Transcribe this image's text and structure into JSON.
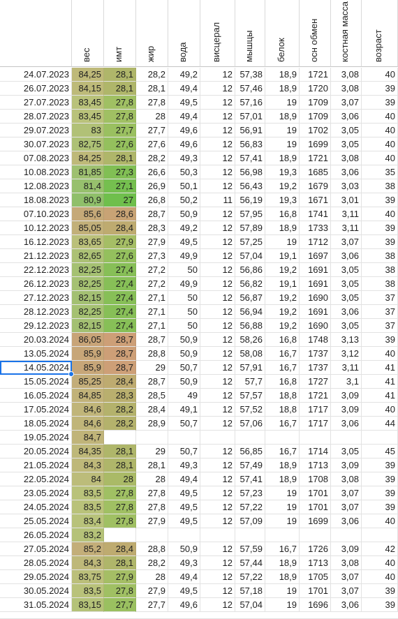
{
  "headers": [
    "",
    "вес",
    "имт",
    "жир",
    "вода",
    "висцерал",
    "мышцы",
    "белок",
    "осн обмен",
    "костная масса",
    "возраст"
  ],
  "colors": {
    "grid": "#e2e2e2",
    "selection": "#1a73e8",
    "weight_scale": [
      "#8fbf6a",
      "#b9c27a",
      "#c8a478"
    ],
    "bmi_scale": [
      "#6fbf4c",
      "#a3c064",
      "#cd9f77"
    ]
  },
  "selected_row": 21,
  "rows": [
    [
      "24.07.2023",
      "84,25",
      "28,1",
      "28,2",
      "49,2",
      "12",
      "57,38",
      "18,9",
      "1721",
      "3,08",
      "40"
    ],
    [
      "26.07.2023",
      "84,15",
      "28,1",
      "28,1",
      "49,4",
      "12",
      "57,46",
      "18,9",
      "1720",
      "3,08",
      "39"
    ],
    [
      "27.07.2023",
      "83,45",
      "27,8",
      "27,8",
      "49,5",
      "12",
      "57,16",
      "19",
      "1709",
      "3,07",
      "39"
    ],
    [
      "28.07.2023",
      "83,45",
      "27,8",
      "28",
      "49,4",
      "12",
      "57,01",
      "18,9",
      "1709",
      "3,06",
      "40"
    ],
    [
      "29.07.2023",
      "83",
      "27,7",
      "27,7",
      "49,6",
      "12",
      "56,91",
      "19",
      "1702",
      "3,05",
      "40"
    ],
    [
      "30.07.2023",
      "82,75",
      "27,6",
      "27,6",
      "49,6",
      "12",
      "56,83",
      "19",
      "1699",
      "3,05",
      "40"
    ],
    [
      "07.08.2023",
      "84,25",
      "28,1",
      "28,2",
      "49,3",
      "12",
      "57,41",
      "18,9",
      "1721",
      "3,08",
      "40"
    ],
    [
      "10.08.2023",
      "81,85",
      "27,3",
      "26,6",
      "50,3",
      "12",
      "56,98",
      "19,3",
      "1685",
      "3,06",
      "35"
    ],
    [
      "12.08.2023",
      "81,4",
      "27,1",
      "26,9",
      "50,1",
      "12",
      "56,43",
      "19,2",
      "1679",
      "3,03",
      "38"
    ],
    [
      "18.08.2023",
      "80,9",
      "27",
      "26,8",
      "50,2",
      "11",
      "56,19",
      "19,3",
      "1671",
      "3,01",
      "39"
    ],
    [
      "07.10.2023",
      "85,6",
      "28,6",
      "28,7",
      "50,9",
      "12",
      "57,95",
      "16,8",
      "1741",
      "3,11",
      "40"
    ],
    [
      "10.12.2023",
      "85,05",
      "28,4",
      "28,3",
      "49,2",
      "12",
      "57,89",
      "18,9",
      "1733",
      "3,11",
      "39"
    ],
    [
      "16.12.2023",
      "83,65",
      "27,9",
      "27,9",
      "49,5",
      "12",
      "57,25",
      "19",
      "1712",
      "3,07",
      "39"
    ],
    [
      "21.12.2023",
      "82,65",
      "27,6",
      "27,3",
      "49,9",
      "12",
      "57,04",
      "19,1",
      "1697",
      "3,06",
      "38"
    ],
    [
      "22.12.2023",
      "82,25",
      "27,4",
      "27,2",
      "50",
      "12",
      "56,86",
      "19,2",
      "1691",
      "3,05",
      "38"
    ],
    [
      "26.12.2023",
      "82,25",
      "27,4",
      "27,2",
      "49,9",
      "12",
      "56,82",
      "19,1",
      "1691",
      "3,05",
      "38"
    ],
    [
      "27.12.2023",
      "82,15",
      "27,4",
      "27,1",
      "50",
      "12",
      "56,87",
      "19,2",
      "1690",
      "3,05",
      "37"
    ],
    [
      "28.12.2023",
      "82,25",
      "27,4",
      "27,1",
      "50",
      "12",
      "56,94",
      "19,2",
      "1691",
      "3,06",
      "37"
    ],
    [
      "29.12.2023",
      "82,15",
      "27,4",
      "27,1",
      "50",
      "12",
      "56,88",
      "19,2",
      "1690",
      "3,05",
      "37"
    ],
    [
      "20.03.2024",
      "86,05",
      "28,7",
      "28,7",
      "50,9",
      "12",
      "58,26",
      "16,8",
      "1748",
      "3,13",
      "39"
    ],
    [
      "13.05.2024",
      "85,9",
      "28,7",
      "28,8",
      "50,9",
      "12",
      "58,08",
      "16,7",
      "1737",
      "3,12",
      "40"
    ],
    [
      "14.05.2024",
      "85,9",
      "28,7",
      "29",
      "50,7",
      "12",
      "57,91",
      "16,7",
      "1737",
      "3,11",
      "41"
    ],
    [
      "15.05.2024",
      "85,25",
      "28,4",
      "28,7",
      "50,9",
      "12",
      "57,7",
      "16,8",
      "1727",
      "3,1",
      "41"
    ],
    [
      "16.05.2024",
      "84,85",
      "28,3",
      "28,5",
      "49",
      "12",
      "57,57",
      "18,8",
      "1721",
      "3,09",
      "41"
    ],
    [
      "17.05.2024",
      "84,6",
      "28,2",
      "28,4",
      "49,1",
      "12",
      "57,52",
      "18,8",
      "1717",
      "3,09",
      "40"
    ],
    [
      "18.05.2024",
      "84,6",
      "28,2",
      "28,9",
      "50,7",
      "12",
      "57,06",
      "16,7",
      "1717",
      "3,06",
      "44"
    ],
    [
      "19.05.2024",
      "84,7",
      "",
      "",
      "",
      "",
      "",
      "",
      "",
      "",
      ""
    ],
    [
      "20.05.2024",
      "84,35",
      "28,1",
      "29",
      "50,7",
      "12",
      "56,85",
      "16,7",
      "1714",
      "3,05",
      "45"
    ],
    [
      "21.05.2024",
      "84,3",
      "28,1",
      "28,1",
      "49,3",
      "12",
      "57,49",
      "18,9",
      "1713",
      "3,09",
      "39"
    ],
    [
      "22.05.2024",
      "84",
      "28",
      "28",
      "49,4",
      "12",
      "57,41",
      "18,9",
      "1708",
      "3,08",
      "39"
    ],
    [
      "23.05.2024",
      "83,5",
      "27,8",
      "27,8",
      "49,5",
      "12",
      "57,23",
      "19",
      "1701",
      "3,07",
      "39"
    ],
    [
      "24.05.2024",
      "83,5",
      "27,8",
      "27,8",
      "49,5",
      "12",
      "57,22",
      "19",
      "1701",
      "3,07",
      "39"
    ],
    [
      "25.05.2024",
      "83,4",
      "27,8",
      "27,9",
      "49,5",
      "12",
      "57,09",
      "19",
      "1699",
      "3,06",
      "40"
    ],
    [
      "26.05.2024",
      "83,2",
      "",
      "",
      "",
      "",
      "",
      "",
      "",
      "",
      ""
    ],
    [
      "27.05.2024",
      "85,2",
      "28,4",
      "28,8",
      "50,9",
      "12",
      "57,59",
      "16,7",
      "1726",
      "3,09",
      "42"
    ],
    [
      "28.05.2024",
      "84,3",
      "28,1",
      "28,2",
      "49,3",
      "12",
      "57,44",
      "18,9",
      "1713",
      "3,08",
      "40"
    ],
    [
      "29.05.2024",
      "83,75",
      "27,9",
      "28",
      "49,4",
      "12",
      "57,22",
      "18,9",
      "1705",
      "3,07",
      "40"
    ],
    [
      "30.05.2024",
      "83,5",
      "27,8",
      "27,9",
      "49,5",
      "12",
      "57,18",
      "19",
      "1701",
      "3,07",
      "39"
    ],
    [
      "31.05.2024",
      "83,15",
      "27,7",
      "27,7",
      "49,6",
      "12",
      "57,04",
      "19",
      "1696",
      "3,06",
      "39"
    ]
  ]
}
